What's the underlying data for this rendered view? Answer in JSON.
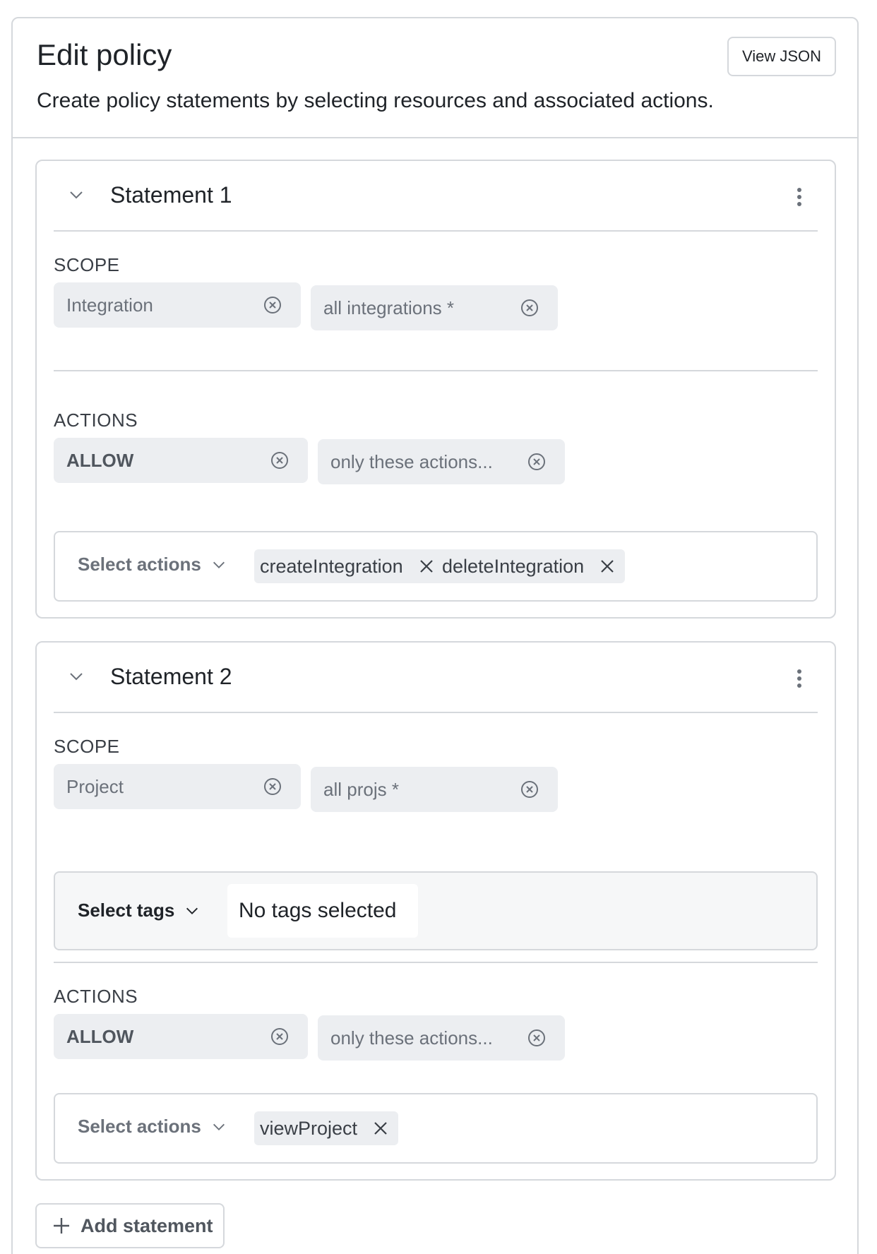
{
  "header": {
    "title": "Edit policy",
    "description": "Create policy statements by selecting resources and associated actions.",
    "view_json_label": "View JSON"
  },
  "statements": [
    {
      "title": "Statement 1",
      "scope_label": "SCOPE",
      "scope_resource": "Integration",
      "scope_selector": "all integrations *",
      "actions_label": "ACTIONS",
      "effect": "ALLOW",
      "action_mode": "only these actions...",
      "select_actions_label": "Select actions",
      "selected_actions": [
        "createIntegration",
        "deleteIntegration"
      ]
    },
    {
      "title": "Statement 2",
      "scope_label": "SCOPE",
      "scope_resource": "Project",
      "scope_selector": "all projs *",
      "select_tags_label": "Select tags",
      "tags_value": "No tags selected",
      "actions_label": "ACTIONS",
      "effect": "ALLOW",
      "action_mode": "only these actions...",
      "select_actions_label": "Select actions",
      "selected_actions": [
        "viewProject"
      ]
    }
  ],
  "footer": {
    "add_statement_label": "Add statement"
  },
  "icons": {
    "expand": "chevron-down-icon",
    "menu": "kebab-menu-icon",
    "clear": "circle-x-icon",
    "remove": "close-icon",
    "add": "plus-icon"
  },
  "colors": {
    "border": "#d5d8dc",
    "pill_bg": "#eceef1",
    "text": "#1f2328",
    "muted": "#6b717a"
  }
}
